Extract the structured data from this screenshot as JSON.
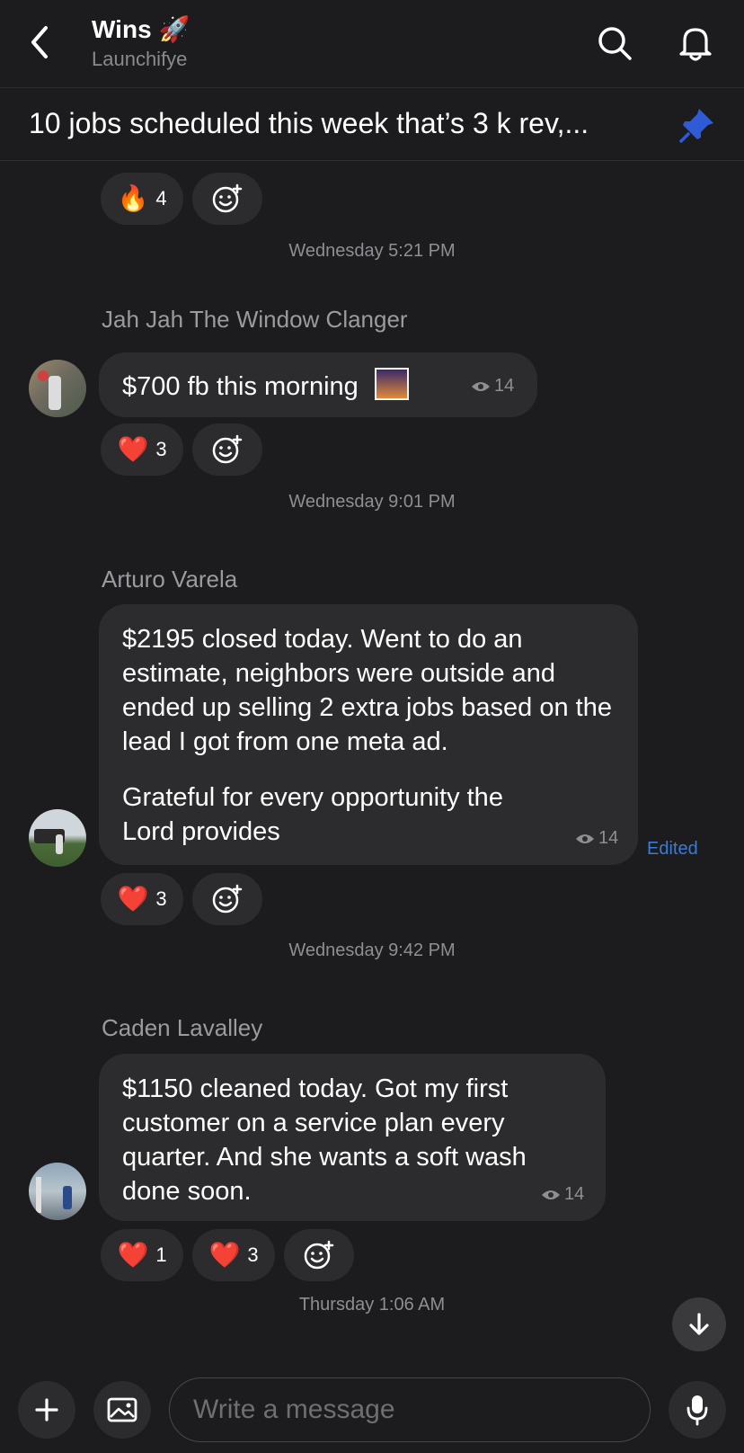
{
  "header": {
    "title": "Wins",
    "title_emoji": "🚀",
    "subtitle": "Launchifye",
    "back_icon": "chevron-left-icon",
    "search_icon": "search-icon",
    "bell_icon": "bell-icon"
  },
  "pinned": {
    "text": "10 jobs scheduled this week that’s 3 k rev,...",
    "icon": "pin-icon",
    "pin_color": "#2f5bd6"
  },
  "messages": [
    {
      "reactions": [
        {
          "emoji": "🔥",
          "count": "4"
        }
      ]
    },
    {
      "timestamp": "Wednesday 5:21 PM",
      "sender": "Jah Jah The Window Clanger",
      "text": "$700 fb this morning",
      "attachment_emoji": "🌄",
      "views": "14",
      "reactions": [
        {
          "emoji": "❤️",
          "count": "3"
        }
      ]
    },
    {
      "timestamp": "Wednesday 9:01 PM",
      "sender": "Arturo Varela",
      "paragraphs": [
        "$2195 closed today. Went to do an estimate, neighbors were outside and ended up selling 2 extra jobs based on the lead I got from one meta ad.",
        "Grateful for every opportunity the Lord provides"
      ],
      "views": "14",
      "edited_label": "Edited",
      "reactions": [
        {
          "emoji": "❤️",
          "count": "3"
        }
      ]
    },
    {
      "timestamp": "Wednesday 9:42 PM",
      "sender": "Caden Lavalley",
      "text": "$1150 cleaned today. Got my first customer on a service plan every quarter. And she wants a soft wash done soon.",
      "views": "14",
      "reactions": [
        {
          "emoji": "❤️",
          "count": "1"
        },
        {
          "emoji": "❤️",
          "count": "3"
        }
      ]
    }
  ],
  "last_timestamp": "Thursday 1:06 AM",
  "composer": {
    "placeholder": "Write a message",
    "add_icon": "plus-icon",
    "image_icon": "image-icon",
    "mic_icon": "microphone-icon"
  },
  "scroll_icon": "arrow-down-icon",
  "colors": {
    "background": "#1c1c1e",
    "bubble": "#2c2c2e",
    "accent": "#3a7bd5"
  }
}
